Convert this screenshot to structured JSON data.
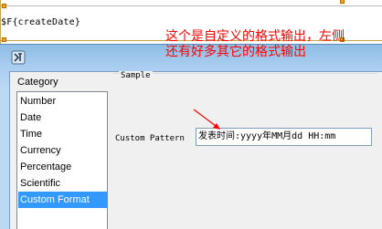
{
  "editor": {
    "field_expression": "$F{createDate}"
  },
  "dialog": {
    "title_icon": "app-icon",
    "category": {
      "label": "Category",
      "items": [
        {
          "label": "Number"
        },
        {
          "label": "Date"
        },
        {
          "label": "Time"
        },
        {
          "label": "Currency"
        },
        {
          "label": "Percentage"
        },
        {
          "label": "Scientific"
        },
        {
          "label": "Custom Format"
        }
      ],
      "selected": "Custom Format"
    },
    "sample": {
      "label": "Sample"
    },
    "custom_pattern": {
      "label": "Custom Pattern",
      "value": "发表时间:yyyy年MM月dd HH:mm"
    }
  },
  "annotation": {
    "line1": "这个是自定义的格式输出，左侧",
    "line2": "还有好多其它的格式输出",
    "color": "#ff0000"
  },
  "colors": {
    "selection": "#3399ff",
    "title_gradient_top": "#8fbde4",
    "dialog_face": "#f0f0f0"
  }
}
